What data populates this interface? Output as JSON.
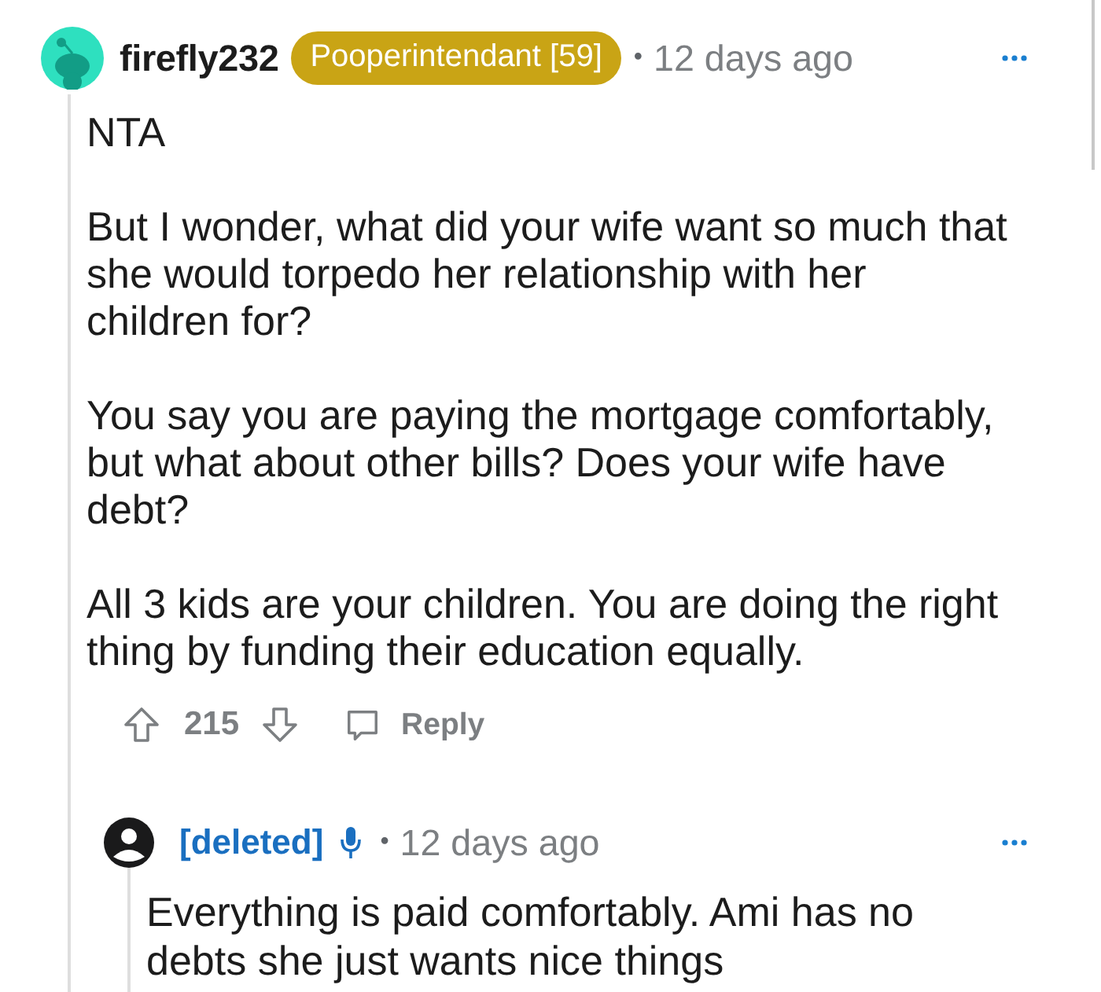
{
  "comment": {
    "author": "firefly232",
    "flair": "Pooperintendant [59]",
    "separator": "•",
    "time": "12 days ago",
    "paragraphs": [
      "NTA",
      "But I wonder, what did your wife want so much that\nshe would torpedo her relationship with her\nchildren for?",
      "You say you are paying the mortgage comfortably,\nbut what about other bills? Does your wife have\ndebt?",
      "All 3 kids are your children. You are doing the right\nthing by funding their education equally."
    ],
    "votes": "215",
    "reply_label": "Reply"
  },
  "reply": {
    "author": "[deleted]",
    "separator": "•",
    "time": "12 days ago",
    "paragraphs": [
      "Everything is paid comfortably. Ami has no\ndebts she just wants nice things"
    ]
  }
}
